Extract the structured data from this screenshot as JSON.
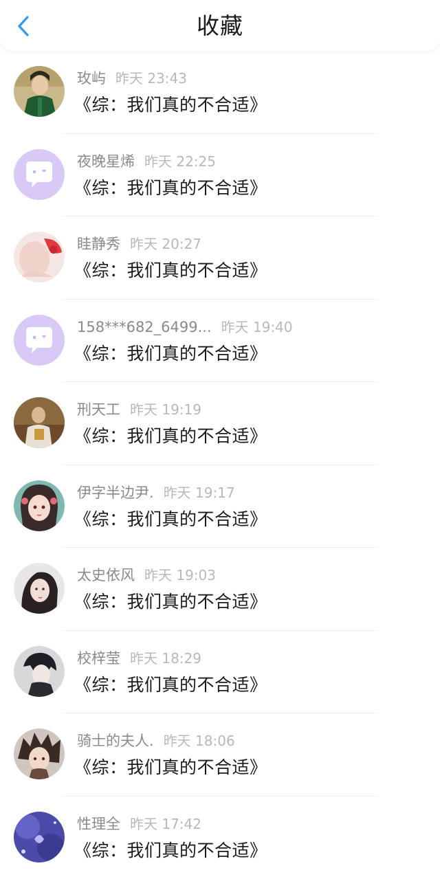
{
  "header": {
    "title": "收藏",
    "back_icon": "chevron-left-icon",
    "accent": "#2b9bf4"
  },
  "items": [
    {
      "name": "玫屿",
      "time": "昨天 23:43",
      "book": "《综：我们真的不合适》",
      "avatar": "photo"
    },
    {
      "name": "夜晚星烯",
      "time": "昨天 22:25",
      "book": "《综：我们真的不合适》",
      "avatar": "default"
    },
    {
      "name": "眭静秀",
      "time": "昨天 20:27",
      "book": "《综：我们真的不合适》",
      "avatar": "photo"
    },
    {
      "name": "158***682_6499...",
      "time": "昨天 19:40",
      "book": "《综：我们真的不合适》",
      "avatar": "default"
    },
    {
      "name": "刑天工",
      "time": "昨天 19:19",
      "book": "《综：我们真的不合适》",
      "avatar": "photo"
    },
    {
      "name": "伊字半边尹.",
      "time": "昨天 19:17",
      "book": "《综：我们真的不合适》",
      "avatar": "photo"
    },
    {
      "name": "太史依风",
      "time": "昨天 19:03",
      "book": "《综：我们真的不合适》",
      "avatar": "photo"
    },
    {
      "name": "校梓莹",
      "time": "昨天 18:29",
      "book": "《综：我们真的不合适》",
      "avatar": "photo"
    },
    {
      "name": "骑士的夫人.",
      "time": "昨天 18:06",
      "book": "《综：我们真的不合适》",
      "avatar": "photo"
    },
    {
      "name": "性理全",
      "time": "昨天 17:42",
      "book": "《综：我们真的不合适》",
      "avatar": "photo"
    }
  ],
  "colors": {
    "name": "#8a8a8a",
    "time": "#b8b8b8",
    "default_avatar": "#d9c9f7"
  }
}
